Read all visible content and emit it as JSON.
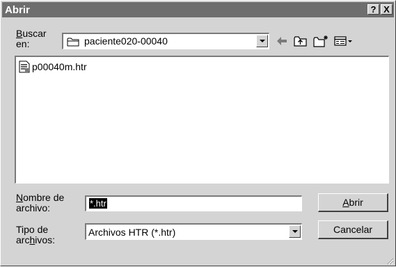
{
  "window": {
    "title": "Abrir",
    "help_glyph": "?",
    "close_glyph": "X"
  },
  "lookin": {
    "label_line1": "Buscar",
    "label_line2": "en:",
    "value": "paciente020-00040"
  },
  "files": [
    {
      "name": "p00040m.htr"
    }
  ],
  "filename": {
    "label_line1": "Nombre de",
    "label_line2": "archivo:",
    "value": "*.htr"
  },
  "filetype": {
    "label_line1": "Tipo de",
    "label_line2": "archivos:",
    "value": "Archivos HTR (*.htr)"
  },
  "buttons": {
    "open": "Abrir",
    "cancel": "Cancelar"
  },
  "icons": {
    "folder": "folder-icon",
    "back": "back-arrow-icon",
    "up": "up-folder-icon",
    "new_folder": "new-folder-icon",
    "view": "view-menu-icon",
    "file": "html-file-icon"
  },
  "colors": {
    "titlebar": "#6e6e6e",
    "face": "#d4d4d4",
    "selection": "#000000"
  }
}
